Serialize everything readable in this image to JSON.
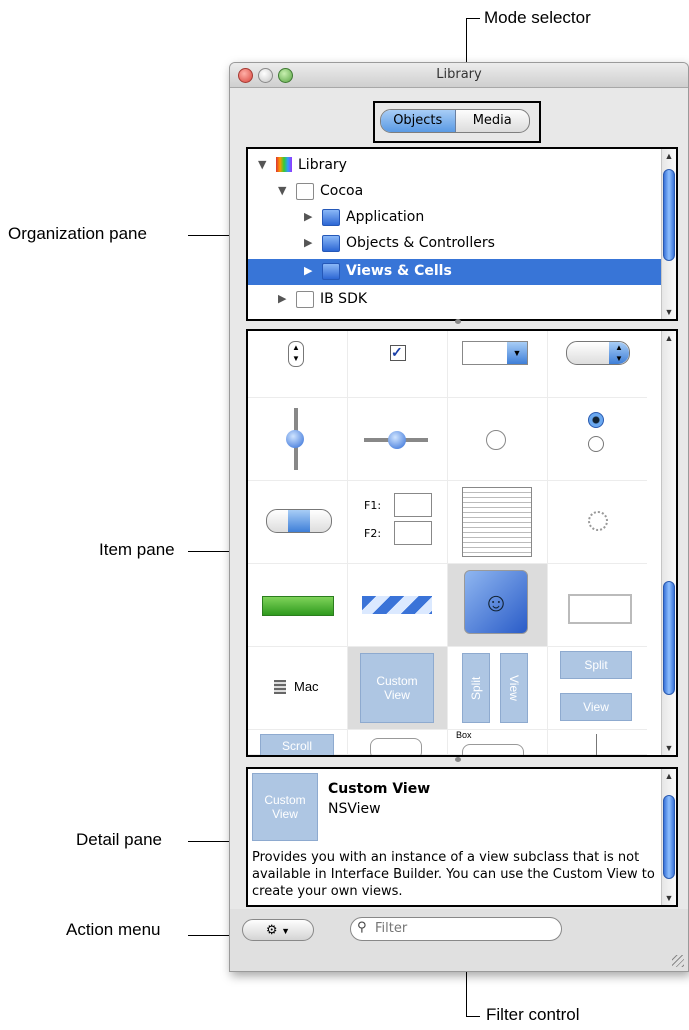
{
  "callouts": {
    "mode_selector": "Mode selector",
    "organization_pane": "Organization pane",
    "item_pane": "Item pane",
    "detail_pane": "Detail pane",
    "action_menu": "Action menu",
    "filter_control": "Filter control"
  },
  "window": {
    "title": "Library"
  },
  "mode_selector": {
    "options": [
      "Objects",
      "Media"
    ],
    "selected": "Objects"
  },
  "tree": [
    {
      "label": "Library",
      "expanded": true,
      "icon": "library-icon"
    },
    {
      "label": "Cocoa",
      "expanded": true,
      "icon": "folder-icon"
    },
    {
      "label": "Application",
      "expanded": false,
      "icon": "blue-folder-icon"
    },
    {
      "label": "Objects & Controllers",
      "expanded": false,
      "icon": "blue-folder-icon"
    },
    {
      "label": "Views & Cells",
      "expanded": false,
      "icon": "blue-folder-icon",
      "selected": true
    },
    {
      "label": "IB SDK",
      "expanded": false,
      "icon": "folder-icon"
    }
  ],
  "items": {
    "form_f1": "F1:",
    "form_f2": "F2:",
    "mac_label": "Mac",
    "custom_view": [
      "Custom",
      "View"
    ],
    "split_view": "Split",
    "view": "View",
    "scroll": "Scroll",
    "box": "Box"
  },
  "detail": {
    "thumb_text": [
      "Custom",
      "View"
    ],
    "name": "Custom View",
    "class": "NSView",
    "description": "Provides you with an instance of a view subclass that is not available in Interface Builder.  You can use the Custom View to create your own views."
  },
  "footer": {
    "action_icon": "gear-icon",
    "filter_placeholder": "Filter"
  },
  "colors": {
    "selection": "#3875d7",
    "accent_blue": "#5a9ae4",
    "custom_view_tile": "#aec6e3"
  }
}
